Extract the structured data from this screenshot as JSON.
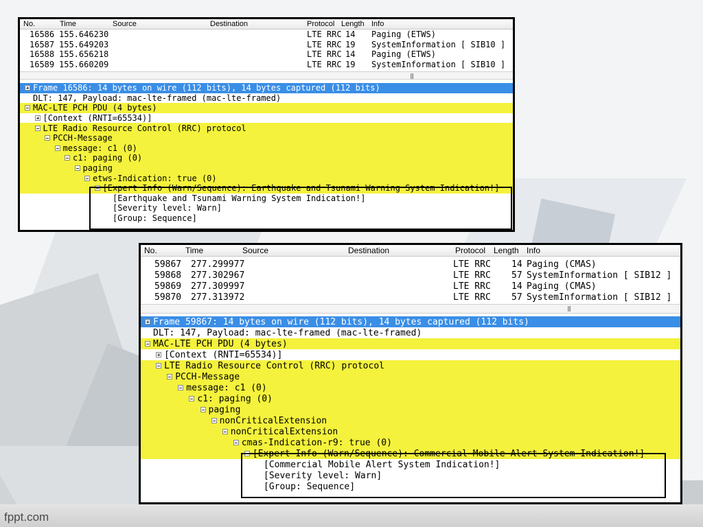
{
  "footer": "fppt.com",
  "captures": [
    {
      "id": "etws",
      "columns": [
        "No.",
        "Time",
        "Source",
        "Destination",
        "Protocol",
        "Length",
        "Info"
      ],
      "packets": [
        {
          "no": "16586",
          "time": "155.646230",
          "source": "",
          "destination": "",
          "protocol": "LTE RRC",
          "length": "14",
          "info": "Paging (ETWS)"
        },
        {
          "no": "16587",
          "time": "155.649203",
          "source": "",
          "destination": "",
          "protocol": "LTE RRC",
          "length": "19",
          "info": "SystemInformation [ SIB10 ]"
        },
        {
          "no": "16588",
          "time": "155.656218",
          "source": "",
          "destination": "",
          "protocol": "LTE RRC",
          "length": "14",
          "info": "Paging (ETWS)"
        },
        {
          "no": "16589",
          "time": "155.660209",
          "source": "",
          "destination": "",
          "protocol": "LTE RRC",
          "length": "19",
          "info": "SystemInformation [ SIB10 ]"
        }
      ],
      "tree": [
        {
          "text": "Frame 16586: 14 bytes on wire (112 bits), 14 bytes captured (112 bits)",
          "level": 0,
          "toggle": "plus",
          "style": "sel"
        },
        {
          "text": "DLT: 147, Payload: mac-lte-framed (mac-lte-framed)",
          "level": 0,
          "toggle": "none",
          "style": "white"
        },
        {
          "text": "MAC-LTE PCH PDU (4 bytes)",
          "level": 0,
          "toggle": "minus",
          "style": "yellow"
        },
        {
          "text": "[Context (RNTI=65534)]",
          "level": 1,
          "toggle": "plus",
          "style": "white"
        },
        {
          "text": "LTE Radio Resource Control (RRC) protocol",
          "level": 1,
          "toggle": "minus",
          "style": "yellow"
        },
        {
          "text": "PCCH-Message",
          "level": 2,
          "toggle": "minus",
          "style": "yellow"
        },
        {
          "text": "message: c1 (0)",
          "level": 3,
          "toggle": "minus",
          "style": "yellow"
        },
        {
          "text": "c1: paging (0)",
          "level": 4,
          "toggle": "minus",
          "style": "yellow"
        },
        {
          "text": "paging",
          "level": 5,
          "toggle": "minus",
          "style": "yellow"
        },
        {
          "text": "etws-Indication: true (0)",
          "level": 6,
          "toggle": "minus",
          "style": "yellow"
        },
        {
          "text": "[Expert Info (Warn/Sequence): Earthquake and Tsunami Warning System Indication!]",
          "level": 7,
          "toggle": "minus",
          "style": "yellow"
        },
        {
          "text": "[Earthquake and Tsunami Warning System Indication!]",
          "level": 8,
          "toggle": "none",
          "style": "white"
        },
        {
          "text": "[Severity level: Warn]",
          "level": 8,
          "toggle": "none",
          "style": "white"
        },
        {
          "text": "[Group: Sequence]",
          "level": 8,
          "toggle": "none",
          "style": "white"
        }
      ]
    },
    {
      "id": "cmas",
      "columns": [
        "No.",
        "Time",
        "Source",
        "Destination",
        "Protocol",
        "Length",
        "Info"
      ],
      "packets": [
        {
          "no": "59867",
          "time": "277.299977",
          "source": "",
          "destination": "",
          "protocol": "LTE RRC",
          "length": "14",
          "info": "Paging (CMAS)"
        },
        {
          "no": "59868",
          "time": "277.302967",
          "source": "",
          "destination": "",
          "protocol": "LTE RRC",
          "length": "57",
          "info": "SystemInformation [ SIB12 ]"
        },
        {
          "no": "59869",
          "time": "277.309997",
          "source": "",
          "destination": "",
          "protocol": "LTE RRC",
          "length": "14",
          "info": "Paging (CMAS)"
        },
        {
          "no": "59870",
          "time": "277.313972",
          "source": "",
          "destination": "",
          "protocol": "LTE RRC",
          "length": "57",
          "info": "SystemInformation [ SIB12 ]"
        }
      ],
      "tree": [
        {
          "text": "Frame 59867: 14 bytes on wire (112 bits), 14 bytes captured (112 bits)",
          "level": 0,
          "toggle": "plus",
          "style": "sel"
        },
        {
          "text": "DLT: 147, Payload: mac-lte-framed (mac-lte-framed)",
          "level": 0,
          "toggle": "none",
          "style": "white"
        },
        {
          "text": "MAC-LTE PCH PDU (4 bytes)",
          "level": 0,
          "toggle": "minus",
          "style": "yellow"
        },
        {
          "text": "[Context (RNTI=65534)]",
          "level": 1,
          "toggle": "plus",
          "style": "white"
        },
        {
          "text": "LTE Radio Resource Control (RRC) protocol",
          "level": 1,
          "toggle": "minus",
          "style": "yellow"
        },
        {
          "text": "PCCH-Message",
          "level": 2,
          "toggle": "minus",
          "style": "yellow"
        },
        {
          "text": "message: c1 (0)",
          "level": 3,
          "toggle": "minus",
          "style": "yellow"
        },
        {
          "text": "c1: paging (0)",
          "level": 4,
          "toggle": "minus",
          "style": "yellow"
        },
        {
          "text": "paging",
          "level": 5,
          "toggle": "minus",
          "style": "yellow"
        },
        {
          "text": "nonCriticalExtension",
          "level": 6,
          "toggle": "minus",
          "style": "yellow"
        },
        {
          "text": "nonCriticalExtension",
          "level": 7,
          "toggle": "minus",
          "style": "yellow"
        },
        {
          "text": "cmas-Indication-r9: true (0)",
          "level": 8,
          "toggle": "minus",
          "style": "yellow"
        },
        {
          "text": "[Expert Info (Warn/Sequence): Commercial Mobile Alert System Indication!]",
          "level": 9,
          "toggle": "minus",
          "style": "yellow"
        },
        {
          "text": "[Commercial Mobile Alert System Indication!]",
          "level": 10,
          "toggle": "none",
          "style": "white"
        },
        {
          "text": "[Severity level: Warn]",
          "level": 10,
          "toggle": "none",
          "style": "white"
        },
        {
          "text": "[Group: Sequence]",
          "level": 10,
          "toggle": "none",
          "style": "white"
        }
      ]
    }
  ]
}
